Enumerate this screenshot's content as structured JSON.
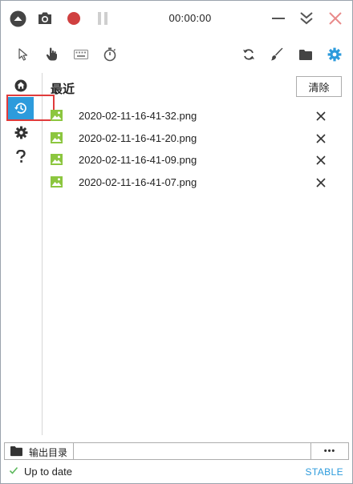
{
  "titlebar": {
    "timer": "00:00:00",
    "colors": {
      "record": "#d04040",
      "close": "#e88a8a",
      "pause": "#cfcfcf",
      "icon": "#444444"
    }
  },
  "toolbar": {
    "tools": [
      "pointer-icon",
      "hand-icon",
      "keyboard-icon",
      "stopwatch-icon"
    ],
    "actions": [
      "refresh-icon",
      "brush-icon",
      "folder-icon",
      "settings-icon"
    ],
    "accent": "#2d9bdc"
  },
  "sidebar": {
    "items": [
      "home-icon",
      "history-icon",
      "gear-icon",
      "help-icon"
    ],
    "active": "history-icon"
  },
  "main": {
    "heading": "最近",
    "clear_label": "清除",
    "files": [
      {
        "name": "2020-02-11-16-41-32.png"
      },
      {
        "name": "2020-02-11-16-41-20.png"
      },
      {
        "name": "2020-02-11-16-41-09.png"
      },
      {
        "name": "2020-02-11-16-41-07.png"
      }
    ],
    "image_icon_color": "#8cc63f"
  },
  "output": {
    "label": "输出目录",
    "path": "",
    "more_label": "•••"
  },
  "status": {
    "text": "Up to date",
    "channel": "STABLE",
    "check_color": "#5cb85c"
  }
}
